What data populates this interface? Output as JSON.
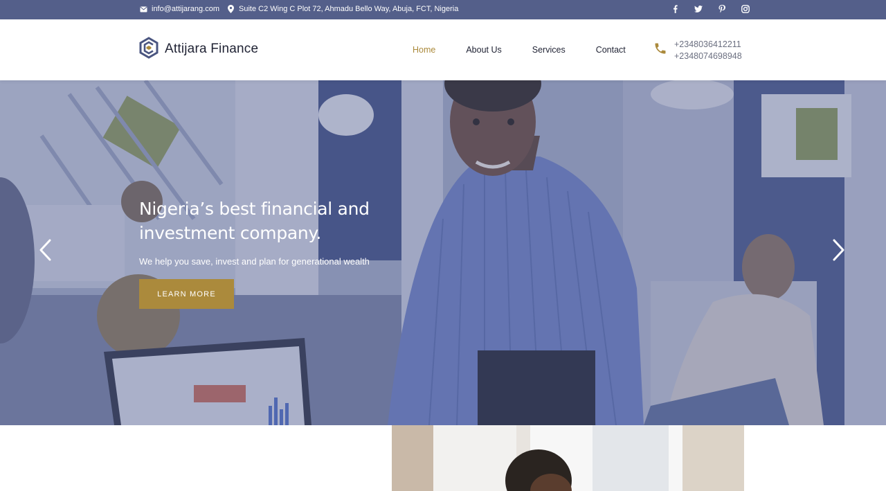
{
  "topbar": {
    "email": "info@attijarang.com",
    "address": "Suite C2 Wing C Plot 72, Ahmadu Bello Way, Abuja, FCT, Nigeria",
    "email_icon": "envelope-icon",
    "address_icon": "map-pin-icon",
    "social": [
      {
        "name": "facebook",
        "icon": "facebook-icon",
        "glyph": "f"
      },
      {
        "name": "twitter",
        "icon": "twitter-icon",
        "glyph": ""
      },
      {
        "name": "pinterest",
        "icon": "pinterest-icon",
        "glyph": ""
      },
      {
        "name": "instagram",
        "icon": "instagram-icon",
        "glyph": ""
      }
    ]
  },
  "header": {
    "logo_text": "Attijara Finance",
    "nav": [
      {
        "label": "Home",
        "active": true
      },
      {
        "label": "About Us",
        "active": false
      },
      {
        "label": "Services",
        "active": false
      },
      {
        "label": "Contact",
        "active": false
      }
    ],
    "phone_icon": "phone-icon",
    "phones": [
      "+2348036412211",
      "+2348074698948"
    ]
  },
  "hero": {
    "title": "Nigeria’s best financial and investment company.",
    "subtitle": "We help you save, invest and plan for generational wealth",
    "button_label": "LEARN MORE",
    "prev_icon": "chevron-left-icon",
    "next_icon": "chevron-right-icon"
  },
  "colors": {
    "topbar": "#545f8a",
    "accent": "#ab8a3c",
    "text_dark": "#1f2233"
  }
}
